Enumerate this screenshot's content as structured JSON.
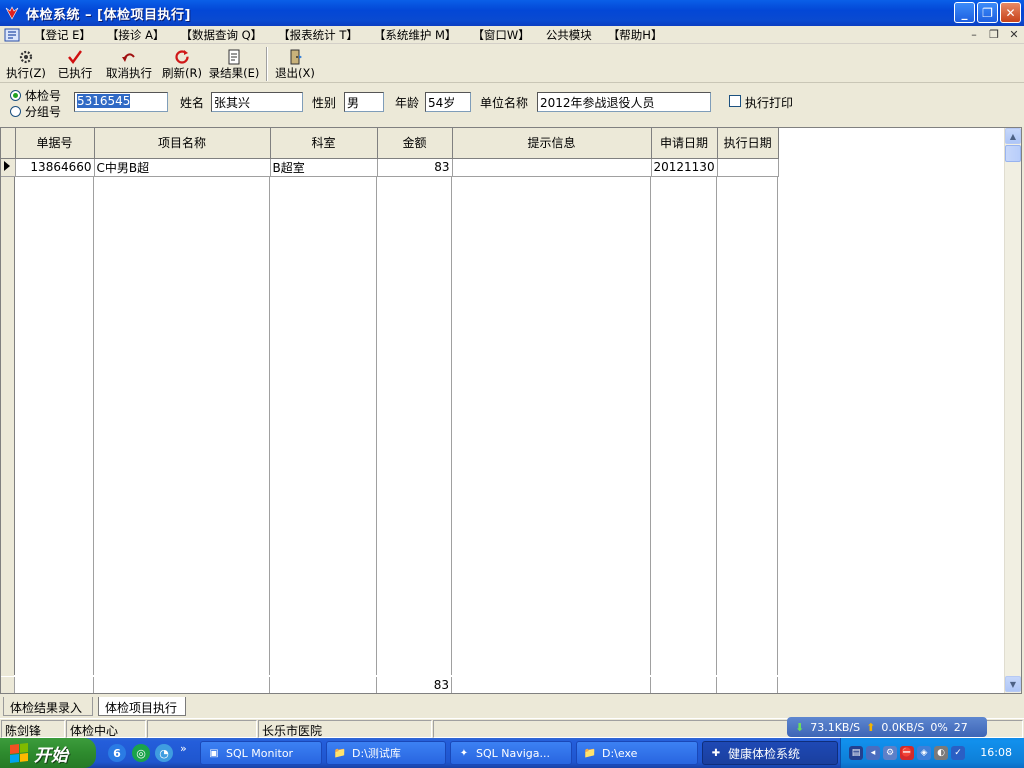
{
  "window": {
    "title": "体检系统 – [体检项目执行]"
  },
  "menu": {
    "items": [
      "【登记 E】",
      "【接诊 A】",
      "【数据查询 Q】",
      "【报表统计 T】",
      "【系统维护 M】",
      "【窗口W】",
      "公共模块",
      "【帮助H】"
    ],
    "mdi_controls": [
      "–",
      "❐",
      "✕"
    ]
  },
  "toolbar": {
    "execute": "执行(Z)",
    "executed": "已执行",
    "cancel_execute": "取消执行",
    "refresh": "刷新(R)",
    "record_result": "录结果(E)",
    "exit": "退出(X)"
  },
  "search": {
    "radio_exam_no": "体检号",
    "radio_group_no": "分组号",
    "exam_no_value": "5316545",
    "name_label": "姓名",
    "name_value": "张其兴",
    "gender_label": "性别",
    "gender_value": "男",
    "age_label": "年龄",
    "age_value": "54岁",
    "org_label": "单位名称",
    "org_value": "2012年参战退役人员",
    "print_label": "执行打印"
  },
  "grid": {
    "headers": [
      "单据号",
      "项目名称",
      "科室",
      "金额",
      "提示信息",
      "申请日期",
      "执行日期"
    ],
    "rows": [
      {
        "doc_no": "13864660",
        "item": "C中男B超",
        "dept": "B超室",
        "amount": "83",
        "tip": "",
        "apply_date": "20121130",
        "exec_date": ""
      }
    ],
    "footer_total": "83"
  },
  "tabs": [
    "体检结果录入",
    "体检项目执行"
  ],
  "status": {
    "user": "陈剑锋",
    "center": "体检中心",
    "hospital": "长乐市医院",
    "net_down": "73.1KB/S",
    "net_up": "0.0KB/S",
    "net_pct": "0%",
    "net_extra": "27"
  },
  "taskbar": {
    "start": "开始",
    "buttons": [
      "SQL Monitor",
      "D:\\测试库",
      "SQL Naviga...",
      "D:\\exe",
      "健康体检系统"
    ],
    "clock": "16:08"
  }
}
